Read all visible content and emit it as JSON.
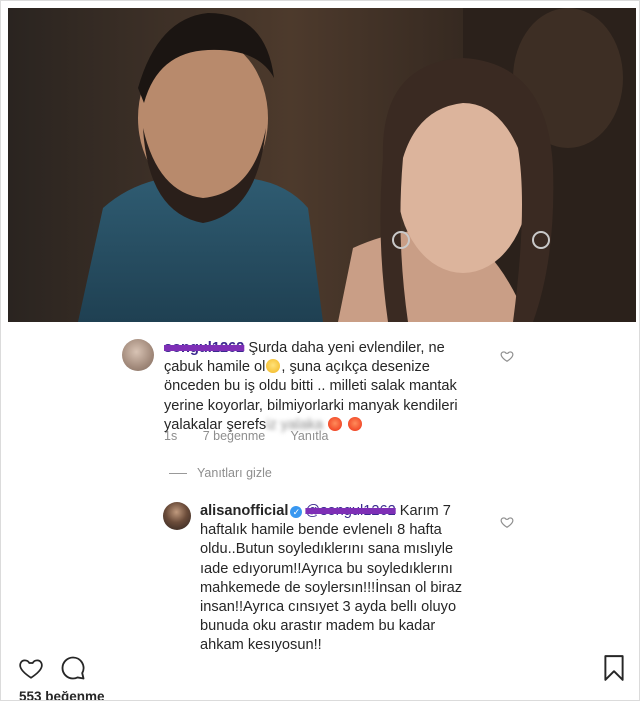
{
  "post": {
    "photo_alt": "",
    "likes_text": "553 beğenme"
  },
  "comment1": {
    "username": "songul1262",
    "text_part1": " Şurda daha yeni evlendiler, ne çabuk hamile  ol",
    "text_part2": ", şuna açıkça desenize önceden bu iş oldu bitti .. milleti salak mantak yerine koyorlar, bilmiyorlarki manyak kendileri yalakalar şerefs",
    "text_blur": "iz yalaka",
    "time": "1s",
    "likes": "7 beğenme",
    "reply": "Yanıtla"
  },
  "replies_toggle": "Yanıtları gizle",
  "comment2": {
    "username": "alisanofficial",
    "mention": "@songul1262",
    "text": " Karım 7 haftalık hamile bende evlenelı 8 hafta oldu..Butun soyledıklerını sana mıslıyle ıade edıyorum!!Ayrıca bu soyledıklerını mahkemede de soylersın!!!İnsan ol biraz insan!!Ayrıca cınsıyet 3 ayda bellı oluyo bunuda oku arastır madem bu kadar ahkam kesıyosun!!"
  },
  "icons": {
    "like": "heart-icon",
    "comment": "comment-bubble-icon",
    "save": "bookmark-icon",
    "comment_like": "heart-small-icon",
    "verified": "verified-badge-icon"
  },
  "colors": {
    "verified": "#3897f0",
    "scribble": "#7e2fb6",
    "muted": "#8e8e8e"
  }
}
